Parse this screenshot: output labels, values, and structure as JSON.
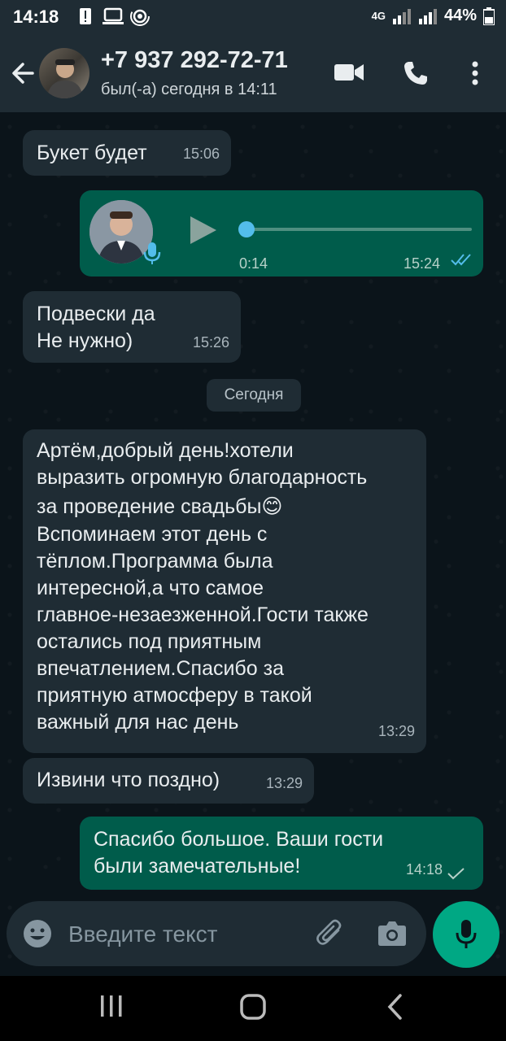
{
  "status_bar": {
    "time": "14:18",
    "network": "4G",
    "battery": "44%"
  },
  "header": {
    "contact_name": "+7 937 292-72-71",
    "last_seen": "был(-а) сегодня в 14:11"
  },
  "messages": [
    {
      "direction": "in",
      "text": "Букет будет",
      "time": "15:06"
    },
    {
      "direction": "out",
      "type": "voice",
      "duration": "0:14",
      "time": "15:24",
      "status": "read"
    },
    {
      "direction": "in",
      "lines": [
        "Подвески да",
        "Не нужно)"
      ],
      "time": "15:26"
    },
    {
      "direction": "in",
      "lines": [
        "Артём,добрый день!хотели",
        "выразить огромную благодарность",
        "за проведение свадьбы😊",
        "Вспоминаем этот день с",
        "тёплом.Программа была",
        "интересной,а что самое",
        "главное-незаезженной.Гости также",
        "остались под приятным",
        "впечатлением.Спасибо за",
        "приятную атмосферу в такой",
        "важный для нас день"
      ],
      "time": "13:29"
    },
    {
      "direction": "in",
      "text": "Извини что поздно)",
      "time": "13:29"
    },
    {
      "direction": "out",
      "lines": [
        "Спасибо большое. Ваши гости",
        "были замечательные!"
      ],
      "time": "14:18",
      "status": "sent"
    }
  ],
  "date_separator": "Сегодня",
  "composer": {
    "placeholder": "Введите текст"
  },
  "icons": {
    "back": "arrow-left-icon",
    "video": "video-call-icon",
    "call": "phone-icon",
    "menu": "more-vert-icon",
    "emoji": "emoji-icon",
    "attach": "attach-icon",
    "camera": "camera-icon",
    "mic": "mic-icon"
  },
  "colors": {
    "incoming_bubble": "#1f2c34",
    "outgoing_bubble": "#005c4b",
    "accent": "#00a884",
    "read_ticks": "#53bdeb"
  }
}
